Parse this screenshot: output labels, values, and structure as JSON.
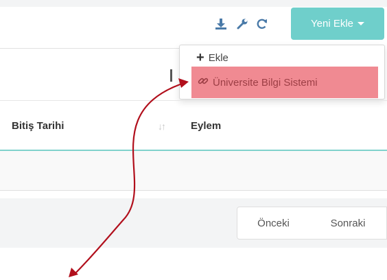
{
  "toolbar": {
    "icons": [
      "download-icon",
      "wrench-icon",
      "refresh-icon"
    ],
    "add_button_label": "Yeni Ekle"
  },
  "dropdown": {
    "items": [
      {
        "label": "Ekle",
        "icon": "plus-icon"
      },
      {
        "label": "Üniversite Bilgi Sistemi",
        "icon": "link-icon",
        "highlighted": true
      }
    ]
  },
  "table": {
    "columns": [
      {
        "label": "Bitiş Tarihi",
        "sortable": true
      },
      {
        "label": "Eylem",
        "sortable": false
      }
    ],
    "rows": [
      []
    ]
  },
  "pagination": {
    "prev_label": "Önceki",
    "next_label": "Sonraki"
  },
  "colors": {
    "accent": "#6fcfcb",
    "highlight": "#f08a92",
    "annotation_arrow": "#b10f1c"
  }
}
